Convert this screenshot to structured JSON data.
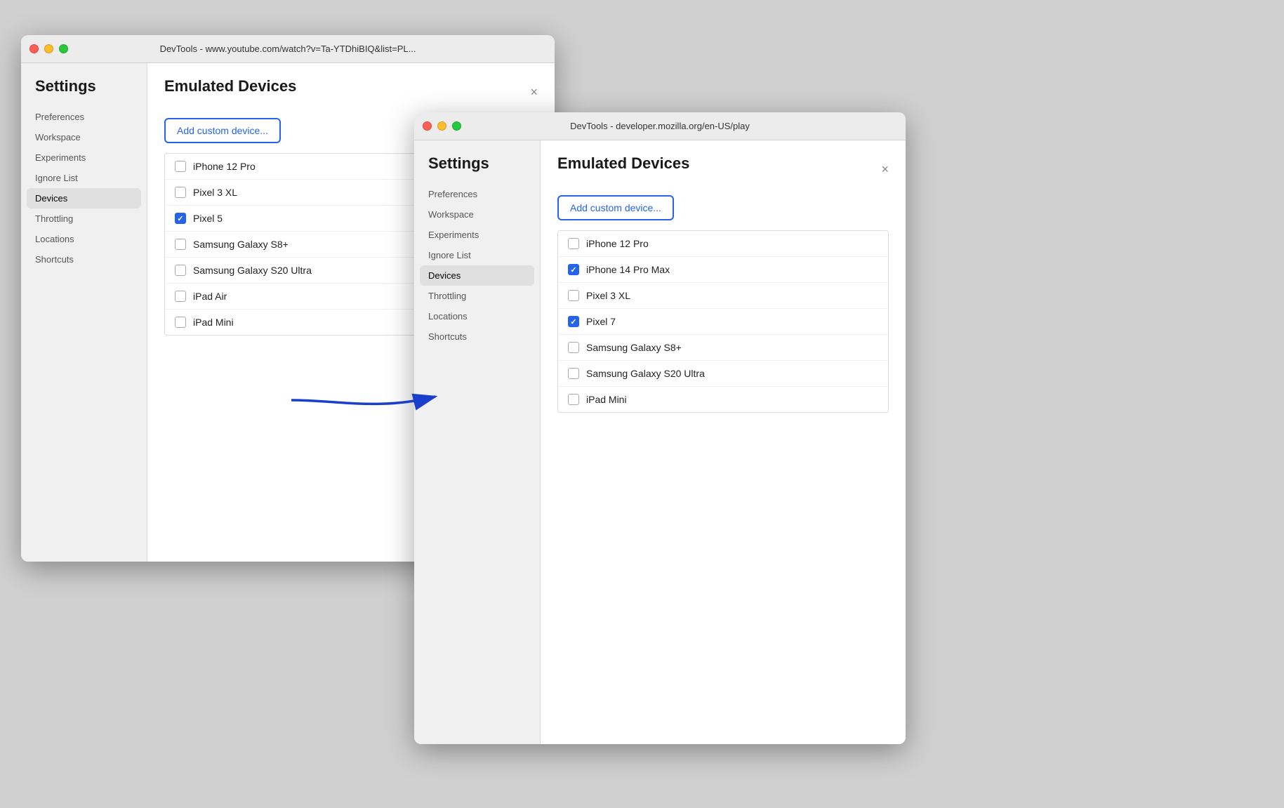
{
  "window1": {
    "title": "DevTools - www.youtube.com/watch?v=Ta-YTDhiBIQ&list=PL...",
    "settings_heading": "Settings",
    "emulated_devices_heading": "Emulated Devices",
    "add_custom_label": "Add custom device...",
    "close_label": "×",
    "sidebar_items": [
      {
        "label": "Preferences",
        "active": false
      },
      {
        "label": "Workspace",
        "active": false
      },
      {
        "label": "Experiments",
        "active": false
      },
      {
        "label": "Ignore List",
        "active": false
      },
      {
        "label": "Devices",
        "active": true
      },
      {
        "label": "Throttling",
        "active": false
      },
      {
        "label": "Locations",
        "active": false
      },
      {
        "label": "Shortcuts",
        "active": false
      }
    ],
    "devices": [
      {
        "name": "iPhone 12 Pro",
        "checked": false
      },
      {
        "name": "Pixel 3 XL",
        "checked": false
      },
      {
        "name": "Pixel 5",
        "checked": true
      },
      {
        "name": "Samsung Galaxy S8+",
        "checked": false
      },
      {
        "name": "Samsung Galaxy S20 Ultra",
        "checked": false
      },
      {
        "name": "iPad Air",
        "checked": false
      },
      {
        "name": "iPad Mini",
        "checked": false
      }
    ]
  },
  "window2": {
    "title": "DevTools - developer.mozilla.org/en-US/play",
    "settings_heading": "Settings",
    "emulated_devices_heading": "Emulated Devices",
    "add_custom_label": "Add custom device...",
    "close_label": "×",
    "sidebar_items": [
      {
        "label": "Preferences",
        "active": false
      },
      {
        "label": "Workspace",
        "active": false
      },
      {
        "label": "Experiments",
        "active": false
      },
      {
        "label": "Ignore List",
        "active": false
      },
      {
        "label": "Devices",
        "active": true
      },
      {
        "label": "Throttling",
        "active": false
      },
      {
        "label": "Locations",
        "active": false
      },
      {
        "label": "Shortcuts",
        "active": false
      }
    ],
    "devices": [
      {
        "name": "iPhone 12 Pro",
        "checked": false
      },
      {
        "name": "iPhone 14 Pro Max",
        "checked": true
      },
      {
        "name": "Pixel 3 XL",
        "checked": false
      },
      {
        "name": "Pixel 7",
        "checked": true
      },
      {
        "name": "Samsung Galaxy S8+",
        "checked": false
      },
      {
        "name": "Samsung Galaxy S20 Ultra",
        "checked": false
      },
      {
        "name": "iPad Mini",
        "checked": false
      }
    ]
  },
  "arrow": {
    "label": "→"
  }
}
